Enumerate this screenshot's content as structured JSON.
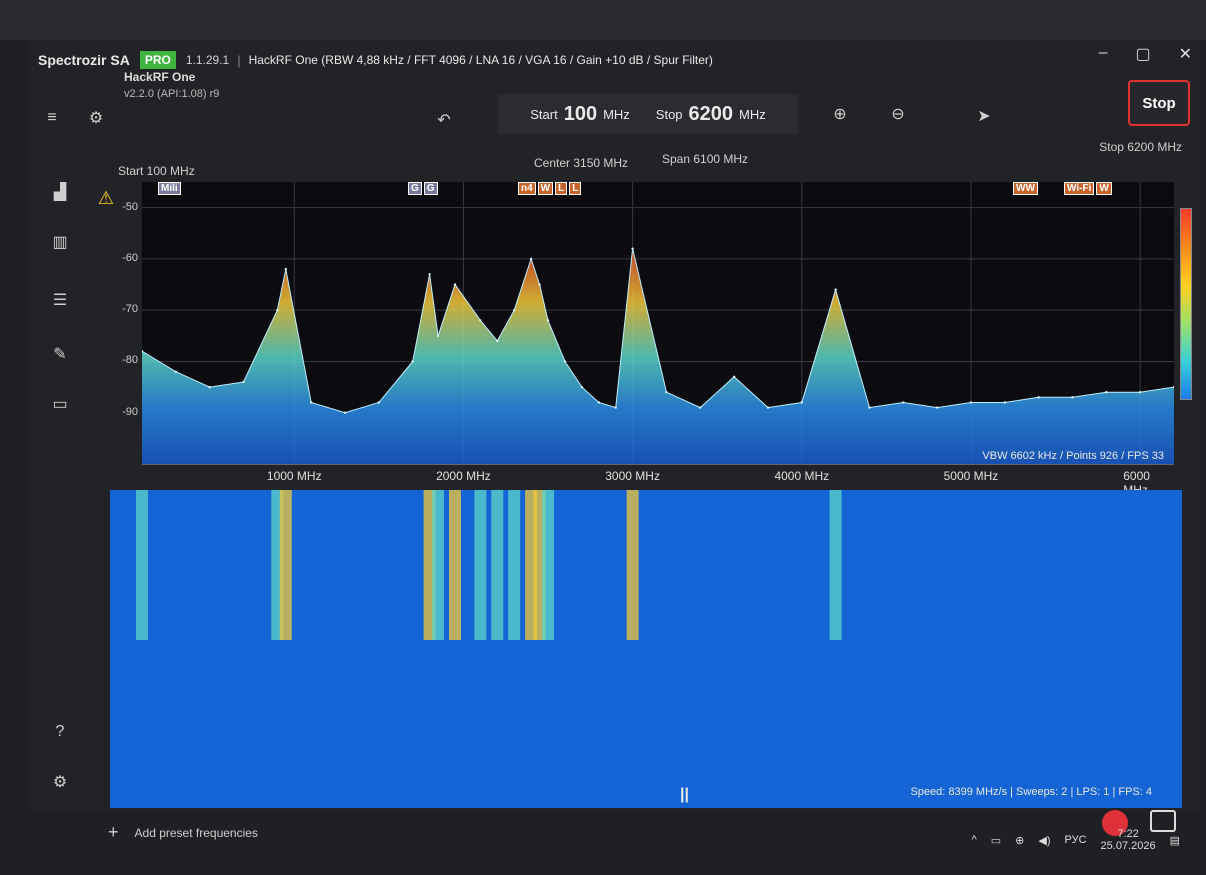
{
  "titlebar": {
    "app_name": "Spectrozir SA",
    "pro_badge": "PRO",
    "version": "1.1.29.1",
    "separator": "|",
    "device_info": "HackRF One (RBW 4,88 kHz / FFT 4096 / LNA 16 / VGA 16 / Gain +10 dB / Spur Filter)",
    "minimize": "–",
    "restore": "▢",
    "close": "✕"
  },
  "toolbar": {
    "device_name": "HackRF One",
    "device_firmware": "v2.2.0 (API:1.08) r9",
    "start_label": "Start",
    "start_value": "100",
    "start_unit": "MHz",
    "stop_label": "Stop",
    "stop_value": "6200",
    "stop_unit": "MHz",
    "stop_button": "Stop"
  },
  "info": {
    "start_left": "Start 100 MHz",
    "center": "Center 3150 MHz",
    "span": "Span 6100 MHz",
    "stop_right": "Stop 6200 MHz",
    "vbw_line": "VBW 6602 kHz / Points 926 / FPS 33",
    "speed_line": "Speed: 8399 MHz/s | Sweeps: 2 | LPS: 1 | FPS: 4"
  },
  "bands": [
    {
      "labels": [
        "Mili"
      ]
    },
    {
      "labels": [
        "G",
        "G"
      ]
    },
    {
      "labels": [
        "n4",
        "W",
        "L",
        "L"
      ]
    },
    {
      "labels": [
        "WW"
      ]
    },
    {
      "labels": [
        "Wi-Fi",
        "W"
      ]
    }
  ],
  "sidebar": {
    "help": "?",
    "add_preset_plus": "+",
    "add_preset_label": "Add preset frequencies"
  },
  "pause_glyph": "||",
  "tray": {
    "lang": "РУС",
    "time": "7:22",
    "date": "25.07.2026"
  },
  "chart_data": {
    "type": "line",
    "xlabel": "",
    "ylabel": "",
    "x_ticks": [
      "1000 MHz",
      "2000 MHz",
      "3000 MHz",
      "4000 MHz",
      "5000 MHz",
      "6000 MHz"
    ],
    "y_ticks": [
      "-50",
      "-60",
      "-70",
      "-80",
      "-90"
    ],
    "xlim": [
      100,
      6200
    ],
    "ylim": [
      -100,
      -45
    ],
    "series": [
      {
        "x": [
          100,
          300,
          500,
          700,
          900,
          950,
          1100,
          1300,
          1500,
          1700,
          1800,
          1850,
          1950,
          2100,
          2200,
          2300,
          2400,
          2450,
          2500,
          2600,
          2700,
          2800,
          2900,
          3000,
          3200,
          3400,
          3600,
          3800,
          4000,
          4200,
          4400,
          4600,
          4800,
          5000,
          5200,
          5400,
          5600,
          5800,
          6000,
          6200
        ],
        "y": [
          -78,
          -82,
          -85,
          -84,
          -70,
          -62,
          -88,
          -90,
          -88,
          -80,
          -63,
          -75,
          -65,
          -72,
          -76,
          -70,
          -60,
          -65,
          -72,
          -80,
          -85,
          -88,
          -89,
          -58,
          -86,
          -89,
          -83,
          -89,
          -88,
          -66,
          -89,
          -88,
          -89,
          -88,
          -88,
          -87,
          -87,
          -86,
          -86,
          -85
        ]
      }
    ]
  }
}
